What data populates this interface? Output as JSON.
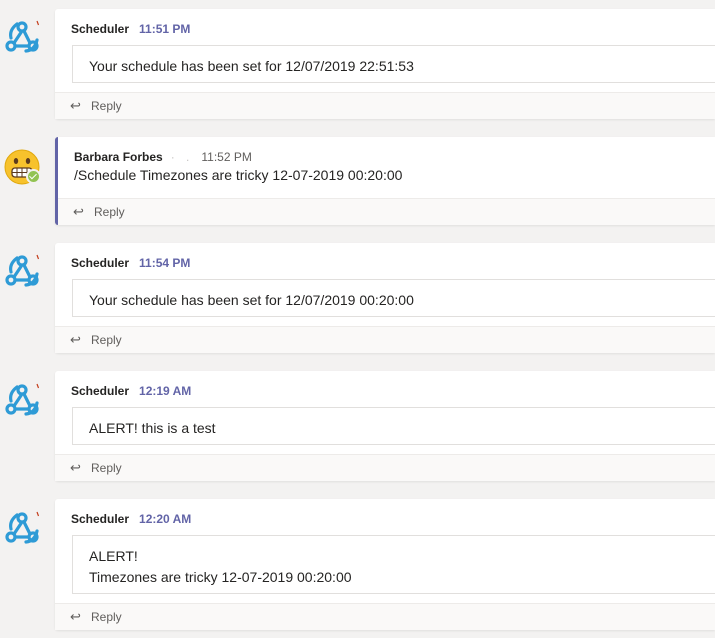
{
  "messages": [
    {
      "author": "Scheduler",
      "time": "11:51 PM",
      "lines": [
        "Your schedule has been set for 12/07/2019 22:51:53"
      ],
      "reply": "Reply"
    },
    {
      "author": "Barbara Forbes",
      "time": "11:52 PM",
      "lines": [
        "/Schedule Timezones are tricky  12-07-2019 00:20:00"
      ],
      "reply": "Reply"
    },
    {
      "author": "Scheduler",
      "time": "11:54 PM",
      "lines": [
        "Your schedule has been set for 12/07/2019 00:20:00"
      ],
      "reply": "Reply"
    },
    {
      "author": "Scheduler",
      "time": "12:19 AM",
      "lines": [
        "ALERT! this is a test"
      ],
      "reply": "Reply"
    },
    {
      "author": "Scheduler",
      "time": "12:20 AM",
      "lines": [
        "ALERT!",
        "Timezones are tricky  12-07-2019 00:20:00"
      ],
      "reply": "Reply"
    }
  ],
  "colors": {
    "accent": "#6264a7",
    "bot_icon": "#2e9bd6",
    "presence": "#92c353"
  },
  "icons": {
    "bot": "webhook-icon",
    "user": "grimacing-emoji-avatar",
    "reply": "reply-arrow-icon",
    "presence": "available-check-icon"
  }
}
